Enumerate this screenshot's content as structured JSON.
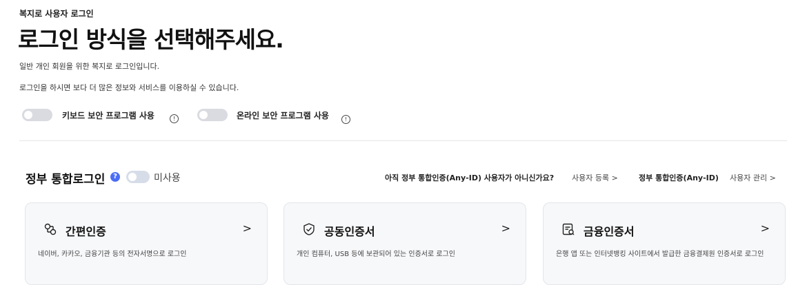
{
  "header": {
    "eyebrow": "복지로 사용자 로그인",
    "title": "로그인 방식을 선택해주세요.",
    "desc1": "일반 개인 회원을 위한 복지로 로그인입니다.",
    "desc2": "로그인을 하시면 보다 더 많은 정보와 서비스를 이용하실 수 있습니다."
  },
  "toggles": {
    "keyboard_label": "키보드 보안 프로그램 사용",
    "online_label": "온라인 보안 프로그램 사용",
    "info_glyph": "!"
  },
  "gov": {
    "title": "정부 통합로그인",
    "help_glyph": "?",
    "unused_label": "미사용",
    "question": "아직 정부 통합인증(Any-ID) 사용자가 아니신가요?",
    "register_link": "사용자 등록 >",
    "anyid_label": "정부 통합인증(Any-ID)",
    "manage_link": "사용자 관리 >"
  },
  "cards": [
    {
      "title": "간편인증",
      "icon": "link-icon",
      "chevron": ">",
      "desc": "네이버, 카카오, 금융기관 등의 전자서명으로 로그인"
    },
    {
      "title": "공동인증서",
      "icon": "shield-check-icon",
      "chevron": ">",
      "desc": "개인 컴퓨터, USB 등에 보관되어 있는 인증서로 로그인"
    },
    {
      "title": "금융인증서",
      "icon": "certificate-icon",
      "chevron": ">",
      "desc": "은행 앱 또는 인터넷뱅킹 사이트에서 발급한 금융결제원 인증서로 로그인"
    }
  ],
  "colors": {
    "accent": "#4c6ef5",
    "toggle_off": "#d9dbe0",
    "card_bg": "#f7f8fa"
  }
}
